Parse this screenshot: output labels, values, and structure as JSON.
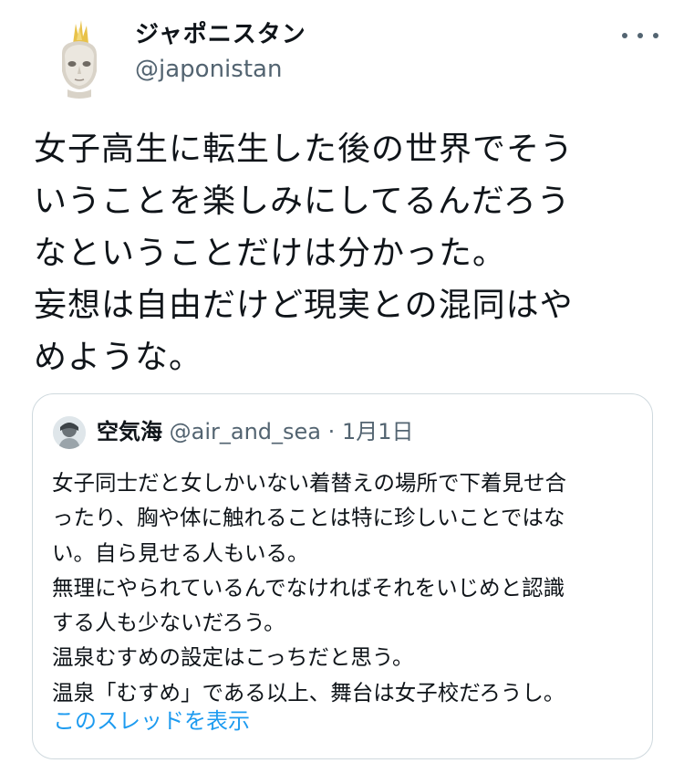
{
  "author": {
    "display_name": "ジャポニスタン",
    "handle": "@japonistan"
  },
  "tweet": {
    "lines": [
      "女子高生に転生した後の世界でそう",
      "いうことを楽しみにしてるんだろう",
      "なということだけは分かった。",
      "妄想は自由だけど現実との混同はや",
      "めような。"
    ]
  },
  "quote": {
    "display_name": "空気海",
    "handle": "@air_and_sea",
    "separator": "·",
    "date": "1月1日",
    "lines": [
      "女子同士だと女しかいない着替えの場所で下着見せ合",
      "ったり、胸や体に触れることは特に珍しいことではな",
      "い。自ら見せる人もいる。",
      "無理にやられているんでなければそれをいじめと認識",
      "する人も少ないだろう。",
      "温泉むすめの設定はこっちだと思う。",
      "温泉「むすめ」である以上、舞台は女子校だろうし。"
    ],
    "show_thread": "このスレッドを表示"
  },
  "colors": {
    "text": "#0f1419",
    "secondary": "#536471",
    "link": "#1d9bf0",
    "border": "#cfd9de"
  },
  "icons": {
    "more": "more-options-icon"
  }
}
